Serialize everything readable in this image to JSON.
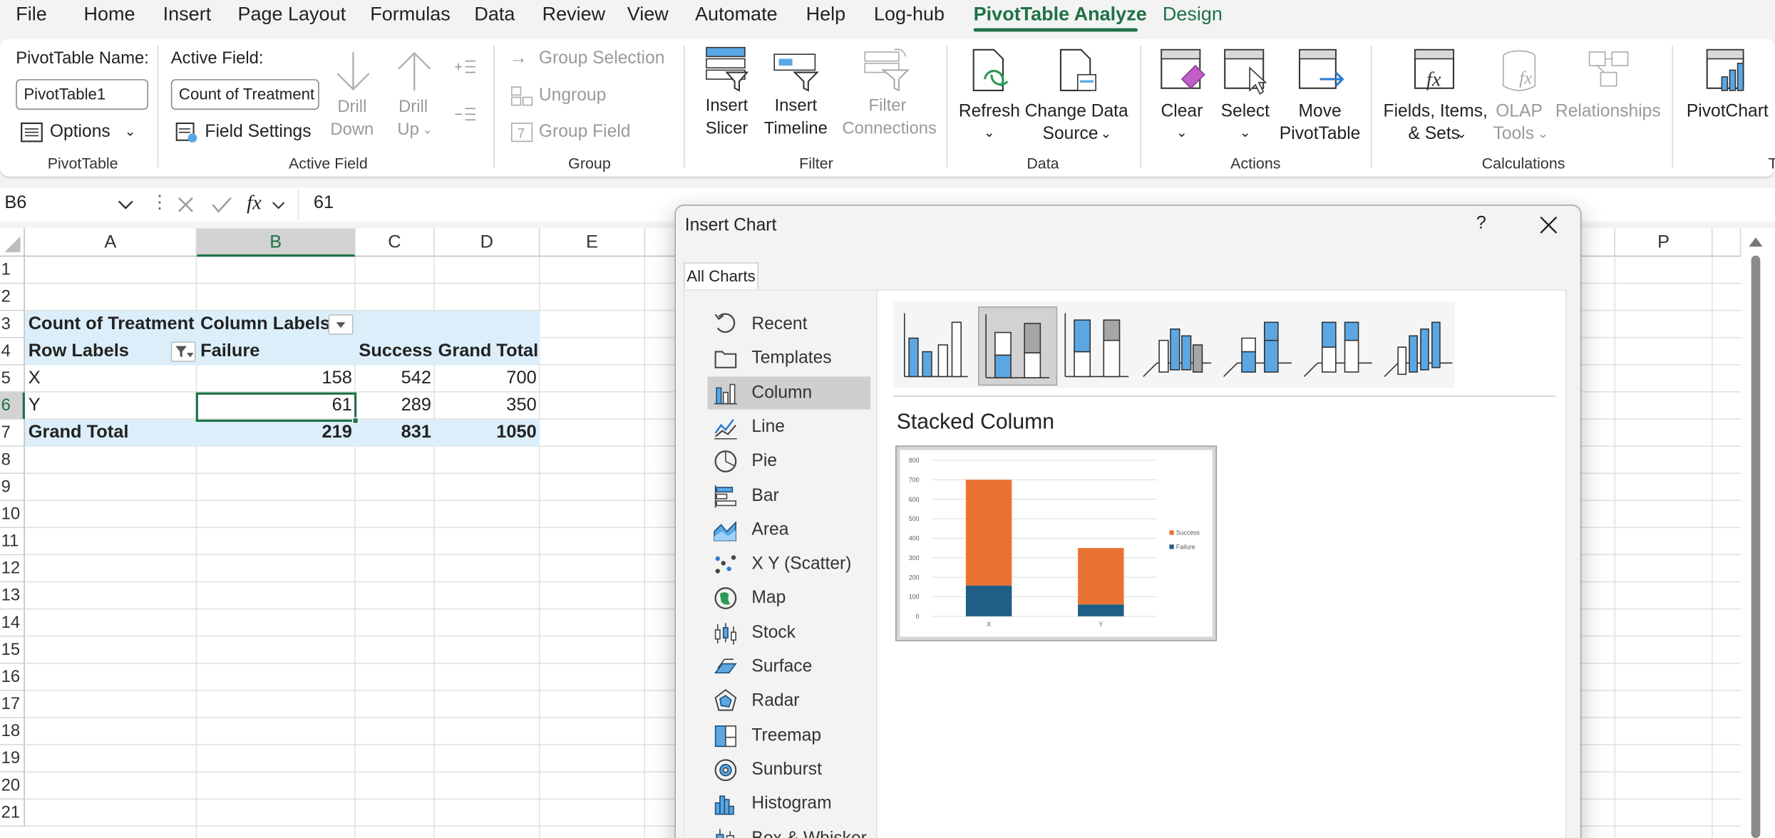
{
  "menu": {
    "items": [
      "File",
      "Home",
      "Insert",
      "Page Layout",
      "Formulas",
      "Data",
      "Review",
      "View",
      "Automate",
      "Help",
      "Log-hub",
      "PivotTable Analyze",
      "Design"
    ],
    "active": "PivotTable Analyze"
  },
  "ribbon": {
    "pivottable": {
      "name_label": "PivotTable Name:",
      "name_value": "PivotTable1",
      "options_label": "Options",
      "group_label": "PivotTable"
    },
    "active_field": {
      "label": "Active Field:",
      "value": "Count of Treatment",
      "field_settings_label": "Field Settings",
      "drill_down_label": [
        "Drill",
        "Down"
      ],
      "drill_up_label": [
        "Drill",
        "Up"
      ],
      "group_label": "Active Field"
    },
    "group": {
      "group_selection_label": "Group Selection",
      "ungroup_label": "Ungroup",
      "group_field_label": "Group Field",
      "group_label": "Group"
    },
    "filter": {
      "insert_slicer_label": [
        "Insert",
        "Slicer"
      ],
      "insert_timeline_label": [
        "Insert",
        "Timeline"
      ],
      "filter_connections_label": [
        "Filter",
        "Connections"
      ],
      "group_label": "Filter"
    },
    "data": {
      "refresh_label": "Refresh",
      "change_source_label": [
        "Change Data",
        "Source"
      ],
      "group_label": "Data"
    },
    "actions": {
      "clear_label": "Clear",
      "select_label": "Select",
      "move_label": [
        "Move",
        "PivotTable"
      ],
      "group_label": "Actions"
    },
    "calculations": {
      "fields_items_label": [
        "Fields, Items,",
        "& Sets"
      ],
      "olap_label": [
        "OLAP",
        "Tools"
      ],
      "relationships_label": "Relationships",
      "group_label": "Calculations"
    },
    "pivotchart_label": "PivotChart"
  },
  "formula_bar": {
    "name_box": "B6",
    "fx": "fx",
    "value": "61"
  },
  "grid": {
    "columns": [
      "A",
      "B",
      "C",
      "D",
      "E",
      "P"
    ],
    "selected_column": "B",
    "rows": [
      "1",
      "2",
      "3",
      "4",
      "5",
      "6",
      "7",
      "8",
      "9",
      "10",
      "11",
      "12",
      "13",
      "14",
      "15",
      "16",
      "17",
      "18",
      "19",
      "20",
      "21"
    ],
    "selected_row": "6",
    "pivot": {
      "header_a": "Count of Treatment",
      "header_b": "Column Labels",
      "row_labels": "Row Labels",
      "col_headers": [
        "Failure",
        "Success",
        "Grand Total"
      ],
      "rows": [
        {
          "label": "X",
          "values": [
            "158",
            "542",
            "700"
          ]
        },
        {
          "label": "Y",
          "values": [
            "61",
            "289",
            "350"
          ]
        }
      ],
      "total": {
        "label": "Grand Total",
        "values": [
          "219",
          "831",
          "1050"
        ]
      }
    }
  },
  "dialog": {
    "title": "Insert Chart",
    "help": "?",
    "close": "✕",
    "tab": "All Charts",
    "chart_types": [
      "Recent",
      "Templates",
      "Column",
      "Line",
      "Pie",
      "Bar",
      "Area",
      "X Y (Scatter)",
      "Map",
      "Stock",
      "Surface",
      "Radar",
      "Treemap",
      "Sunburst",
      "Histogram",
      "Box & Whisker"
    ],
    "selected_type": "Column",
    "selected_subtype_name": "Stacked Column"
  },
  "chart_data": {
    "type": "bar",
    "stacked": true,
    "categories": [
      "X",
      "Y"
    ],
    "series": [
      {
        "name": "Failure",
        "values": [
          158,
          61
        ],
        "color": "#1f5f86"
      },
      {
        "name": "Success",
        "values": [
          542,
          289
        ],
        "color": "#eb7332"
      }
    ],
    "yticks": [
      "0",
      "100",
      "200",
      "300",
      "400",
      "500",
      "600",
      "700",
      "800"
    ],
    "ylim": [
      0,
      800
    ],
    "legend_position": "right",
    "legend_order": [
      "Success",
      "Failure"
    ]
  },
  "colors": {
    "accent": "#1e7145",
    "pivot_band": "#dceefa",
    "icon_blue": "#5ba7e3"
  }
}
